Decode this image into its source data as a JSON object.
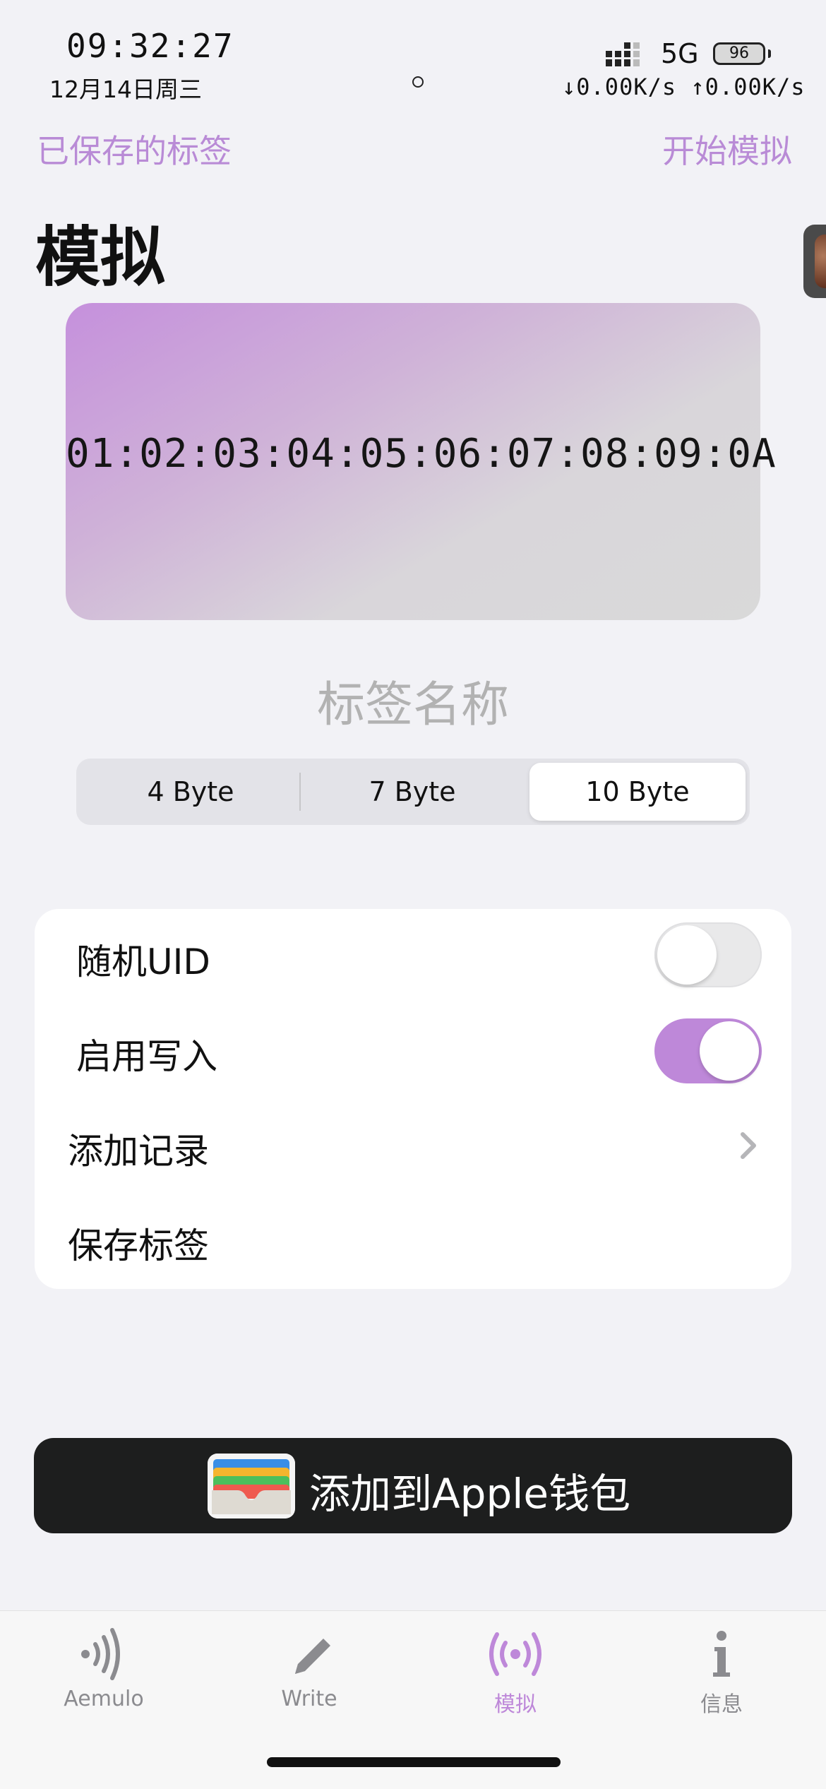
{
  "status_bar": {
    "time": "09:32:27",
    "date": "12月14日周三",
    "network": "5G",
    "battery": "96",
    "speed": "↓0.00K/s ↑0.00K/s"
  },
  "nav": {
    "left": "已保存的标签",
    "right": "开始模拟",
    "title": "模拟"
  },
  "card": {
    "uid": "01:02:03:04:05:06:07:08:09:0A",
    "gradient_start": "#c590dc",
    "gradient_end": "#d9d9d9"
  },
  "tag_name_placeholder": "标签名称",
  "segment": {
    "options": [
      "4 Byte",
      "7 Byte",
      "10 Byte"
    ],
    "selected": "10 Byte"
  },
  "settings": {
    "random_uid": {
      "label": "随机UID",
      "enabled": false
    },
    "enable_write": {
      "label": "启用写入",
      "enabled": true
    },
    "add_record": "添加记录",
    "save_tag": "保存标签"
  },
  "wallet_button": "添加到Apple钱包",
  "tabbar": {
    "tabs": [
      {
        "label": "Aemulo",
        "icon": "nfc-signal-icon"
      },
      {
        "label": "Write",
        "icon": "pencil-icon"
      },
      {
        "label": "模拟",
        "icon": "broadcast-icon",
        "active": true
      },
      {
        "label": "信息",
        "icon": "info-icon"
      }
    ]
  },
  "colors": {
    "accent": "#be88d9",
    "background": "#f2f2f6",
    "dark_button": "#1d1e1e"
  }
}
